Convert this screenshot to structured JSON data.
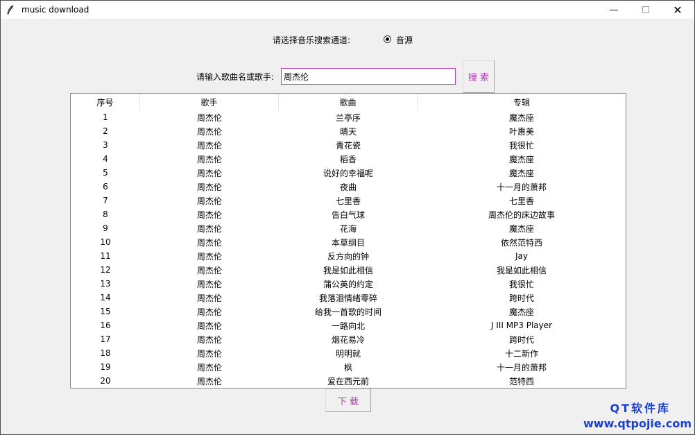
{
  "window": {
    "title": "music download",
    "minimize_glyph": "—",
    "close_glyph": "✕"
  },
  "source": {
    "label": "请选择音乐搜索通道:",
    "option_label": "音源",
    "selected": true
  },
  "search": {
    "label": "请输入歌曲名或歌手:",
    "value": "周杰伦",
    "button_label": "搜 索"
  },
  "table": {
    "headers": [
      "序号",
      "歌手",
      "歌曲",
      "专辑"
    ],
    "rows": [
      [
        "1",
        "周杰伦",
        "兰亭序",
        "魔杰座"
      ],
      [
        "2",
        "周杰伦",
        "晴天",
        "叶惠美"
      ],
      [
        "3",
        "周杰伦",
        "青花瓷",
        "我很忙"
      ],
      [
        "4",
        "周杰伦",
        "稻香",
        "魔杰座"
      ],
      [
        "5",
        "周杰伦",
        "说好的幸福呢",
        "魔杰座"
      ],
      [
        "6",
        "周杰伦",
        "夜曲",
        "十一月的萧邦"
      ],
      [
        "7",
        "周杰伦",
        "七里香",
        "七里香"
      ],
      [
        "8",
        "周杰伦",
        "告白气球",
        "周杰伦的床边故事"
      ],
      [
        "9",
        "周杰伦",
        "花海",
        "魔杰座"
      ],
      [
        "10",
        "周杰伦",
        "本草纲目",
        "依然范特西"
      ],
      [
        "11",
        "周杰伦",
        "反方向的钟",
        "Jay"
      ],
      [
        "12",
        "周杰伦",
        "我是如此相信",
        "我是如此相信"
      ],
      [
        "13",
        "周杰伦",
        "蒲公英的约定",
        "我很忙"
      ],
      [
        "14",
        "周杰伦",
        "我落泪情绪零碎",
        "跨时代"
      ],
      [
        "15",
        "周杰伦",
        "给我一首歌的时间",
        "魔杰座"
      ],
      [
        "16",
        "周杰伦",
        "一路向北",
        "J III MP3 Player"
      ],
      [
        "17",
        "周杰伦",
        "烟花易冷",
        "跨时代"
      ],
      [
        "18",
        "周杰伦",
        "明明就",
        "十二新作"
      ],
      [
        "19",
        "周杰伦",
        "枫",
        "十一月的萧邦"
      ],
      [
        "20",
        "周杰伦",
        "爱在西元前",
        "范特西"
      ]
    ]
  },
  "download": {
    "button_label": "下 载"
  },
  "watermark": {
    "line1": "QT软件库",
    "line2": "www.qtpojie.com"
  },
  "colors": {
    "accent_text": "#b03ab0",
    "input_border": "#c832c8",
    "watermark": "#1a3fd6"
  },
  "icons": {
    "app": "feather-icon",
    "minimize": "minimize-icon",
    "maximize": "maximize-icon",
    "close": "close-icon"
  }
}
